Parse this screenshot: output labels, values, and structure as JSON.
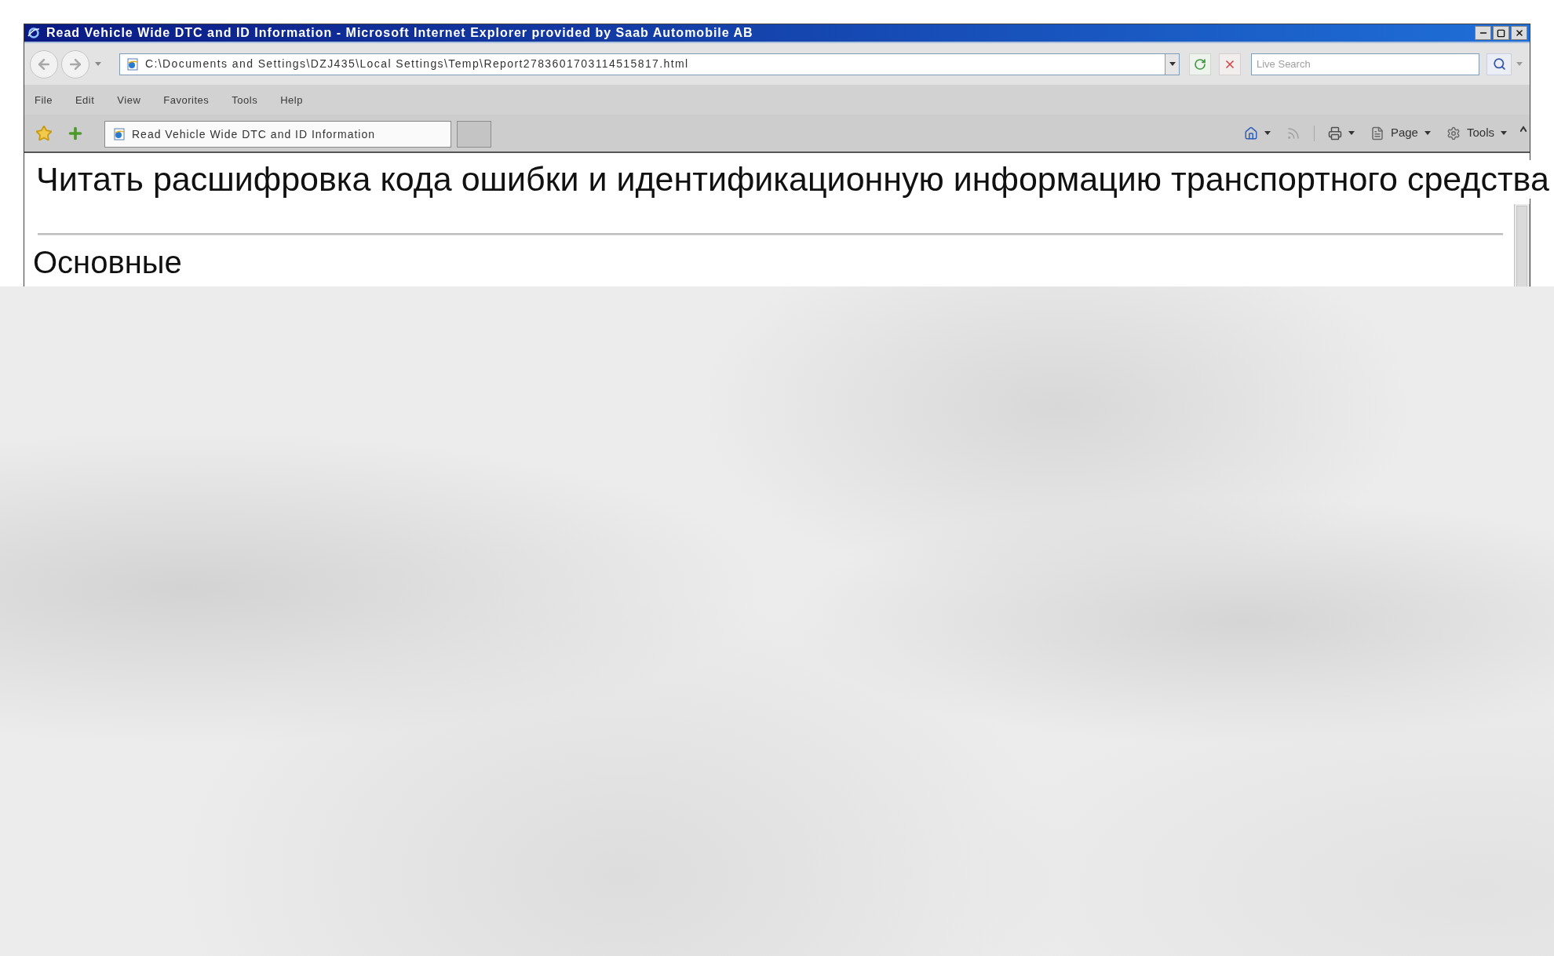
{
  "window": {
    "title": "Read Vehicle Wide DTC and ID Information - Microsoft Internet Explorer provided by Saab Automobile AB"
  },
  "address_bar": {
    "value": "C:\\Documents and Settings\\DZJ435\\Local Settings\\Temp\\Report2783601703114515817.html"
  },
  "search": {
    "placeholder": "Live Search"
  },
  "menu": [
    "File",
    "Edit",
    "View",
    "Favorites",
    "Tools",
    "Help"
  ],
  "tabs": [
    {
      "label": "Read Vehicle Wide DTC and ID Information",
      "selected": true
    }
  ],
  "command_bar": [
    {
      "kind": "home"
    },
    {
      "kind": "feeds"
    },
    {
      "kind": "print"
    },
    {
      "kind": "page",
      "label": "Page"
    },
    {
      "kind": "tools",
      "label": "Tools"
    }
  ],
  "page": {
    "heading": "Читать расшифровка кода ошибки и идентификационную информацию транспортного средства",
    "section_heading": "Основные"
  }
}
